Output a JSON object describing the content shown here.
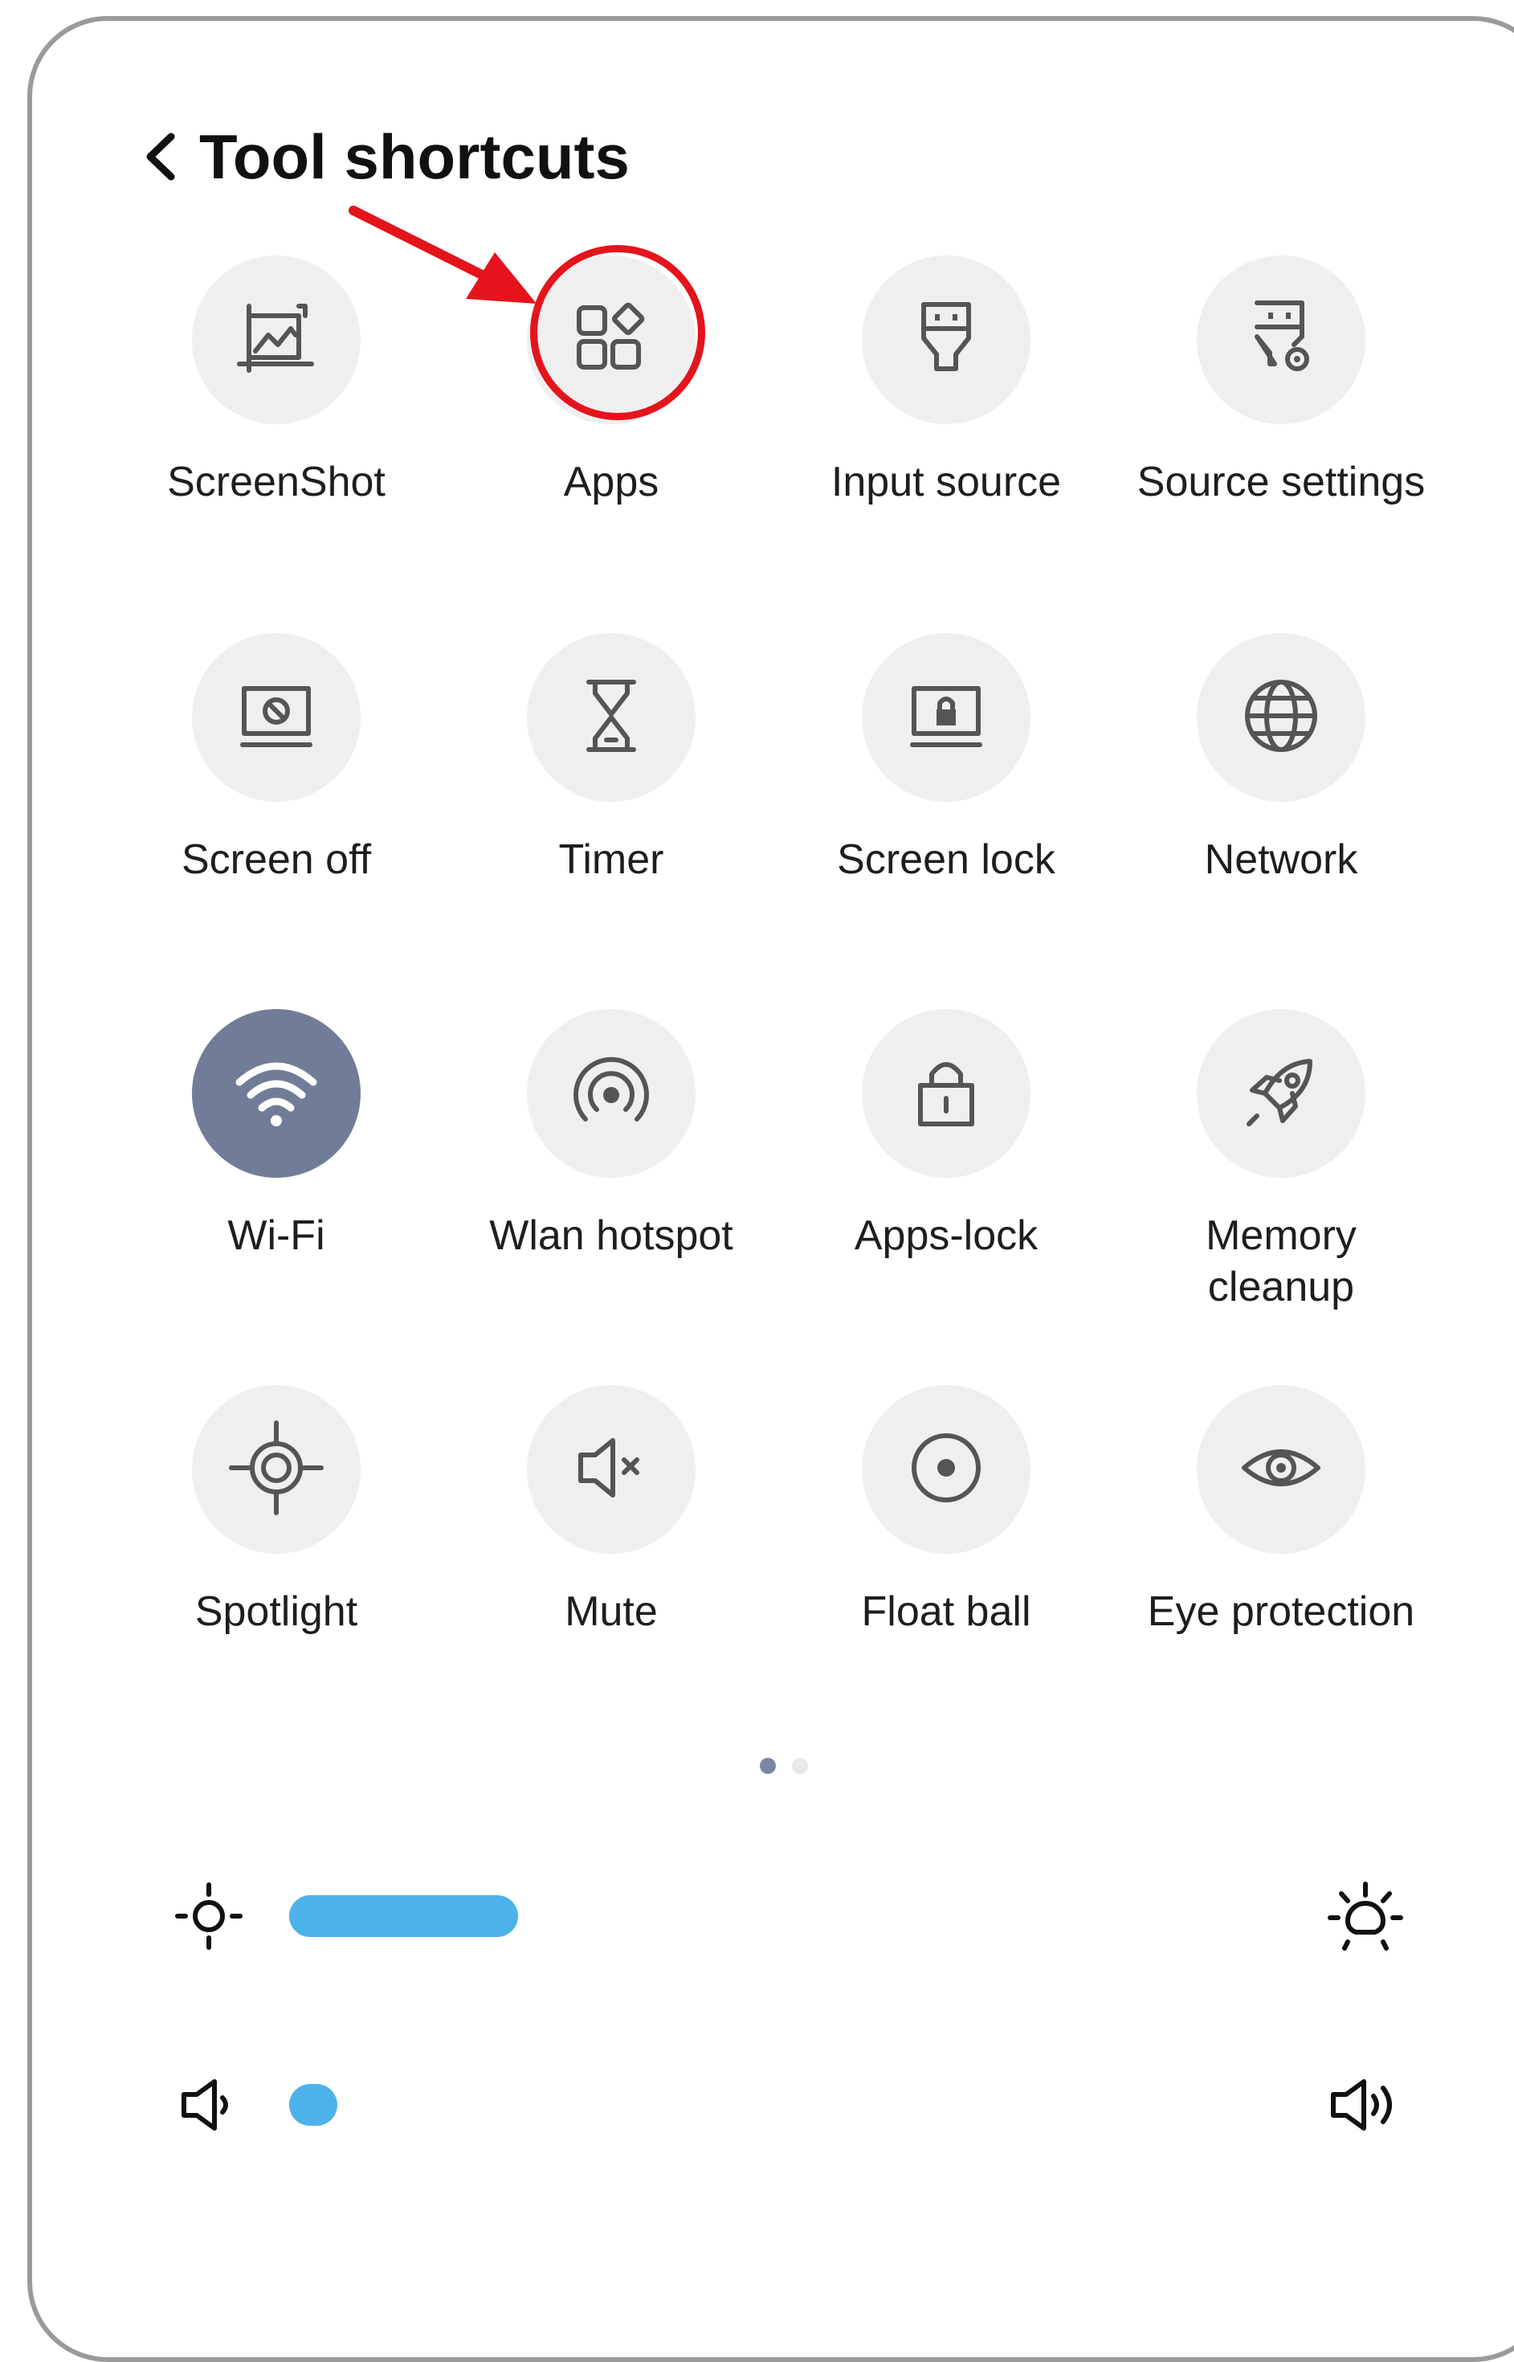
{
  "header": {
    "title": "Tool shortcuts"
  },
  "tiles": [
    {
      "label": "ScreenShot",
      "icon": "screenshot-icon",
      "active": false
    },
    {
      "label": "Apps",
      "icon": "apps-icon",
      "active": false
    },
    {
      "label": "Input source",
      "icon": "input-source-icon",
      "active": false
    },
    {
      "label": "Source settings",
      "icon": "source-settings-icon",
      "active": false
    },
    {
      "label": "Screen off",
      "icon": "screen-off-icon",
      "active": false
    },
    {
      "label": "Timer",
      "icon": "hourglass-icon",
      "active": false
    },
    {
      "label": "Screen lock",
      "icon": "screen-lock-icon",
      "active": false
    },
    {
      "label": "Network",
      "icon": "globe-icon",
      "active": false
    },
    {
      "label": "Wi-Fi",
      "icon": "wifi-icon",
      "active": true
    },
    {
      "label": "Wlan hotspot",
      "icon": "hotspot-icon",
      "active": false
    },
    {
      "label": "Apps-lock",
      "icon": "padlock-icon",
      "active": false
    },
    {
      "label": "Memory cleanup",
      "icon": "rocket-icon",
      "active": false
    },
    {
      "label": "Spotlight",
      "icon": "crosshair-icon",
      "active": false
    },
    {
      "label": "Mute",
      "icon": "mute-icon",
      "active": false
    },
    {
      "label": "Float ball",
      "icon": "float-ball-icon",
      "active": false
    },
    {
      "label": "Eye protection",
      "icon": "eye-icon",
      "active": false
    }
  ],
  "pagination": {
    "pages": 2,
    "current": 1
  },
  "brightness": {
    "level": 0.23,
    "low_icon": "brightness-low-icon",
    "high_icon": "brightness-high-icon"
  },
  "volume": {
    "level": 0.0,
    "low_icon": "volume-low-icon",
    "high_icon": "volume-high-icon"
  },
  "colors": {
    "accent": "#4db2ea",
    "active_tile": "#717d98",
    "tile_bg": "#efefef",
    "icon": "#555555",
    "annotation": "#e5131c"
  },
  "annotation": {
    "target": "Apps"
  }
}
